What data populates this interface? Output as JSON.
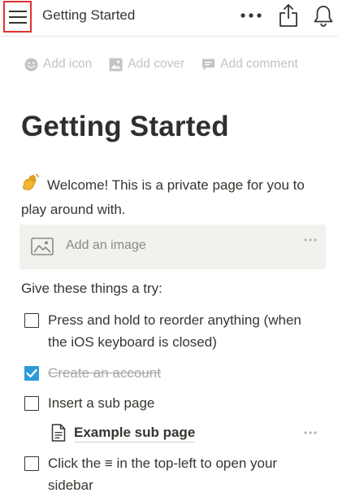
{
  "topbar": {
    "title": "Getting Started",
    "menu_icon": "hamburger-menu-icon",
    "more_icon": "more-horizontal-icon",
    "share_icon": "share-icon",
    "notifications_icon": "bell-icon"
  },
  "page_actions": [
    {
      "label": "Add icon",
      "icon": "smiley-icon"
    },
    {
      "label": "Add cover",
      "icon": "image-icon"
    },
    {
      "label": "Add comment",
      "icon": "comment-icon"
    }
  ],
  "page": {
    "title": "Getting Started",
    "welcome_text": "Welcome! This is a private page for you to play around with.",
    "image_block_label": "Add an image",
    "try_heading": "Give these things a try:"
  },
  "todos": [
    {
      "text": "Press and hold to reorder anything (when the iOS keyboard is closed)",
      "checked": false
    },
    {
      "text": "Create an account",
      "checked": true
    },
    {
      "text": "Insert a sub page",
      "checked": false
    },
    {
      "text": "Click the ≡ in the top-left to open your sidebar",
      "checked": false
    }
  ],
  "subpage": {
    "label": "Example sub page",
    "icon": "document-icon"
  },
  "colors": {
    "text": "#37352f",
    "muted": "#c4c3c0",
    "checkbox_checked": "#2e9bd8",
    "highlight_border": "#e03131",
    "image_block_bg": "#f2f1ee"
  }
}
